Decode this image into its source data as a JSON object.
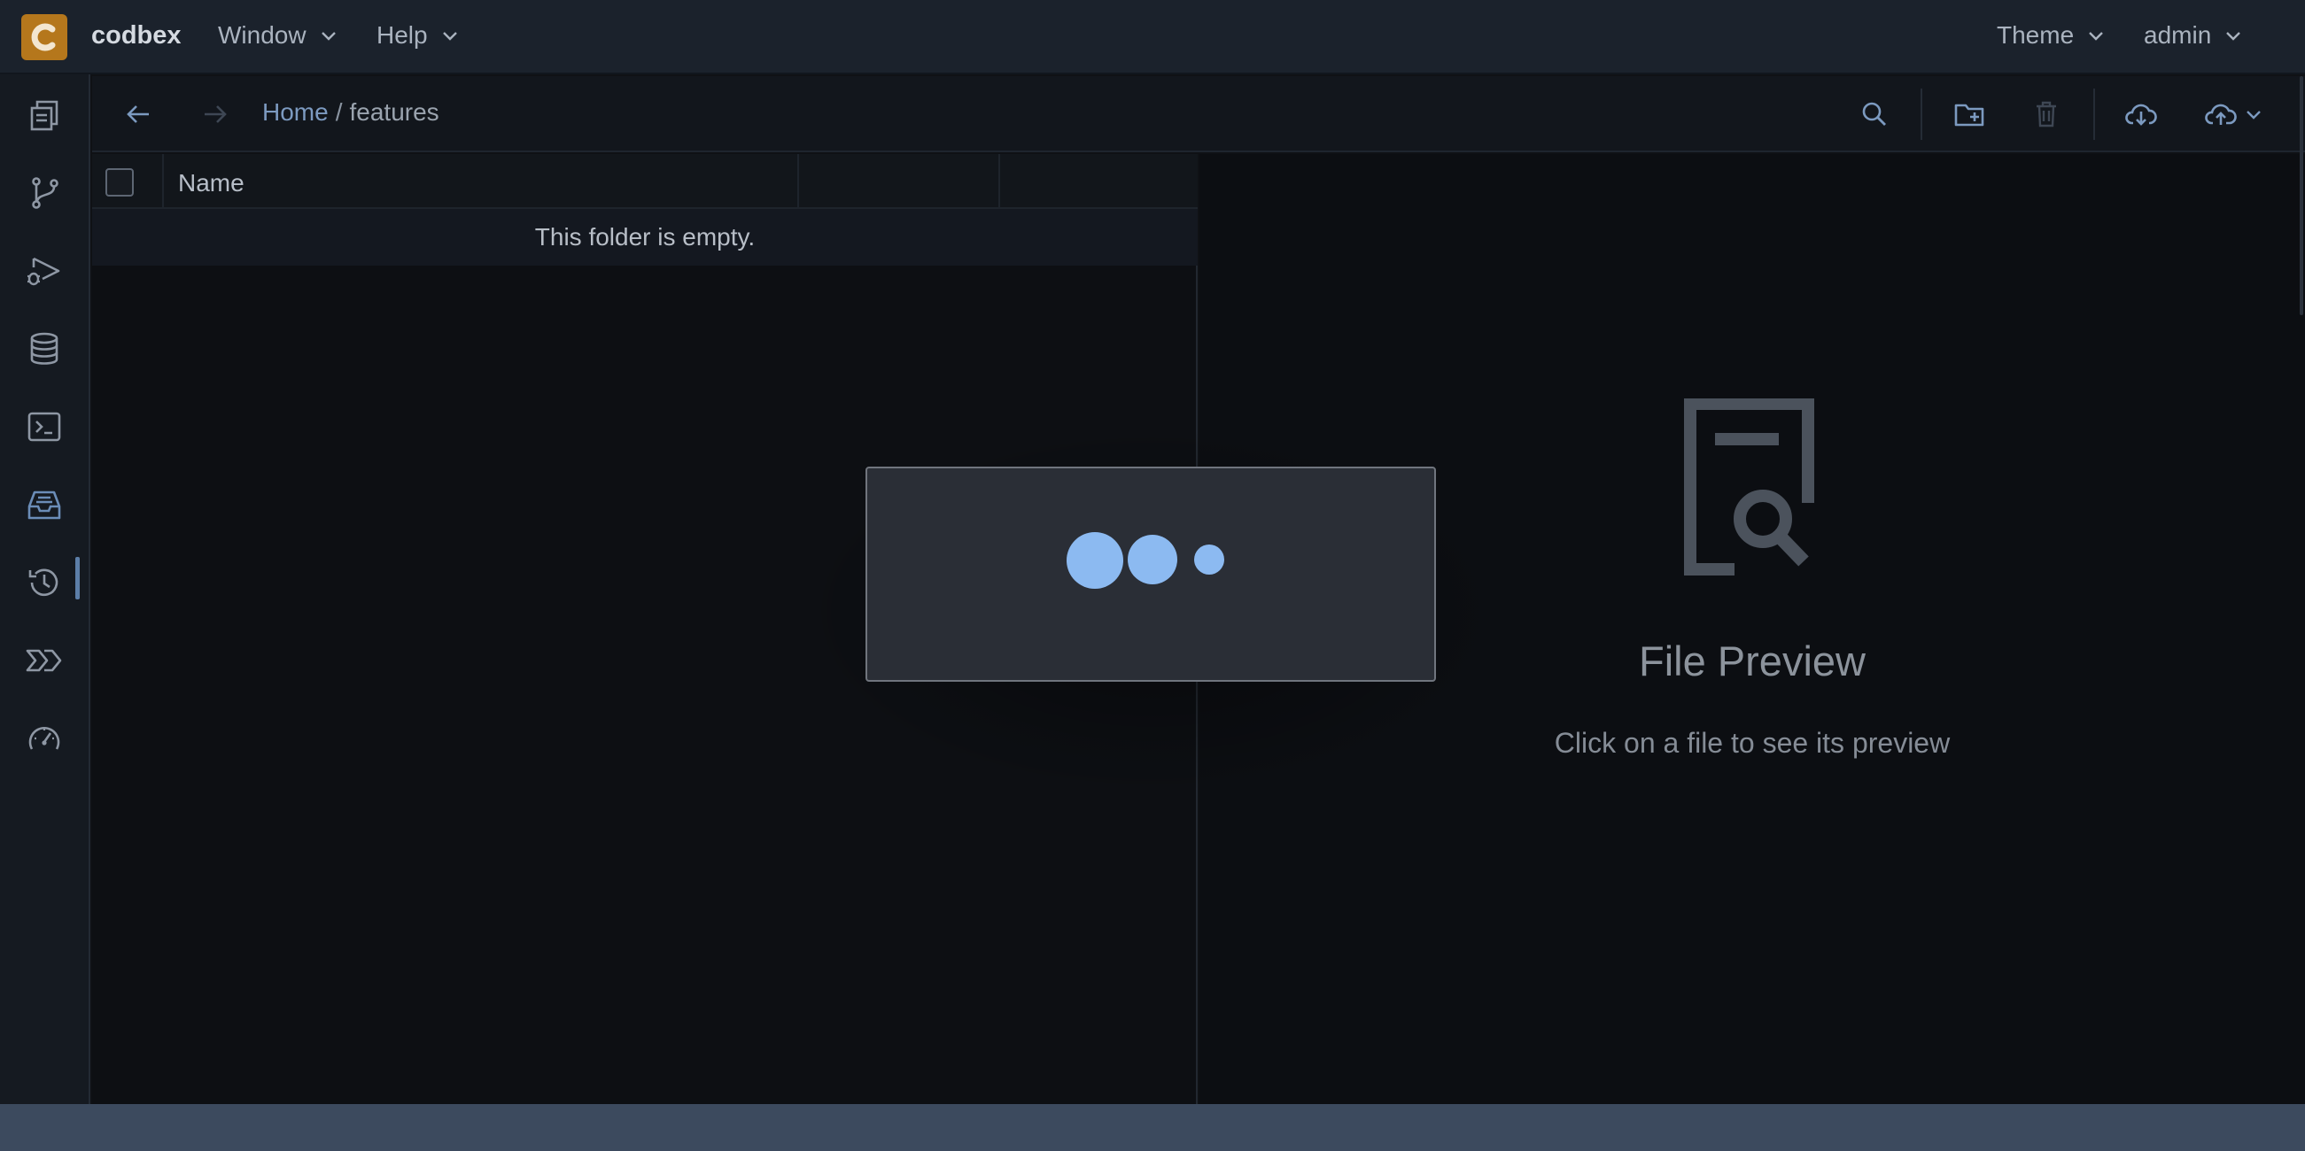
{
  "app": {
    "brand": "codbex",
    "logo_icon": "codbex-logo-icon",
    "accent": "#b5771c"
  },
  "menu": {
    "window_label": "Window",
    "help_label": "Help",
    "theme_label": "Theme",
    "user_label": "admin"
  },
  "sidebar": {
    "items": [
      {
        "name": "sidebar-item-workspace",
        "icon": "documents-icon"
      },
      {
        "name": "sidebar-item-git",
        "icon": "git-branch-icon"
      },
      {
        "name": "sidebar-item-debug",
        "icon": "debug-run-icon"
      },
      {
        "name": "sidebar-item-database",
        "icon": "database-icon"
      },
      {
        "name": "sidebar-item-terminal",
        "icon": "terminal-icon"
      },
      {
        "name": "sidebar-item-documents",
        "icon": "inbox-tray-icon",
        "active": true
      },
      {
        "name": "sidebar-item-history",
        "icon": "history-icon"
      },
      {
        "name": "sidebar-item-pipelines",
        "icon": "chevrons-icon"
      },
      {
        "name": "sidebar-item-operations",
        "icon": "gauge-icon"
      }
    ]
  },
  "toolbar": {
    "breadcrumb_home": "Home",
    "breadcrumb_separator": "/",
    "breadcrumb_current": "features"
  },
  "table": {
    "columns": [
      "Name",
      "",
      ""
    ],
    "empty_text": "This folder is empty."
  },
  "preview": {
    "title": "File Preview",
    "subtitle": "Click on a file to see its preview"
  },
  "colors": {
    "link": "#7c9ac0",
    "busy_dots": "#8cbaf1",
    "statusbar": "#3c4a5e"
  }
}
